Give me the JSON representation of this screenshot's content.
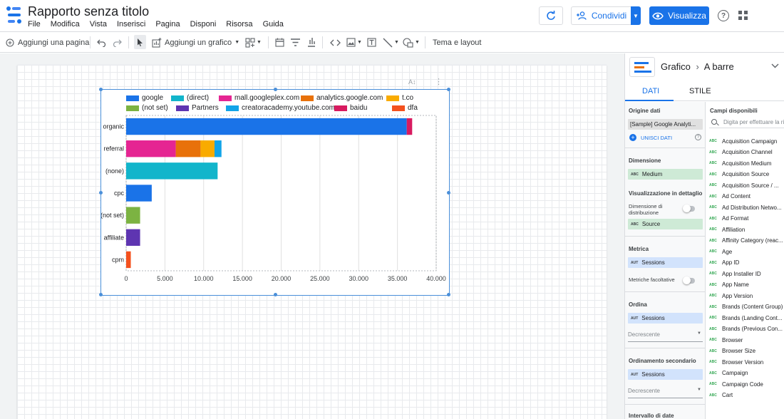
{
  "header": {
    "title": "Rapporto senza titolo",
    "menu": [
      "File",
      "Modifica",
      "Vista",
      "Inserisci",
      "Pagina",
      "Disponi",
      "Risorsa",
      "Guida"
    ],
    "share_label": "Condividi",
    "view_label": "Visualizza",
    "help_glyph": "?"
  },
  "toolbar": {
    "add_page": "Aggiungi una pagina",
    "add_chart": "Aggiungi un grafico",
    "theme_layout": "Tema e layout"
  },
  "chart_data": {
    "type": "bar",
    "orientation": "horizontal",
    "stacked": true,
    "categories": [
      "organic",
      "referral",
      "(none)",
      "cpc",
      "(not set)",
      "affiliate",
      "cpm"
    ],
    "series": [
      {
        "name": "google",
        "color": "#1a73e8",
        "values": [
          36200,
          0,
          0,
          3300,
          0,
          0,
          0
        ]
      },
      {
        "name": "(direct)",
        "color": "#12b5cb",
        "values": [
          0,
          0,
          11800,
          0,
          0,
          0,
          0
        ]
      },
      {
        "name": "mall.googleplex.com",
        "color": "#e52592",
        "values": [
          0,
          6400,
          0,
          0,
          0,
          0,
          0
        ]
      },
      {
        "name": "analytics.google.com",
        "color": "#e8710a",
        "values": [
          0,
          3200,
          0,
          0,
          0,
          0,
          0
        ]
      },
      {
        "name": "t.co",
        "color": "#f9ab00",
        "values": [
          0,
          1800,
          0,
          0,
          0,
          0,
          0
        ]
      },
      {
        "name": "(not set)",
        "color": "#7cb342",
        "values": [
          0,
          0,
          0,
          0,
          1800,
          0,
          0
        ]
      },
      {
        "name": "Partners",
        "color": "#5e35b1",
        "values": [
          0,
          0,
          0,
          0,
          0,
          1800,
          0
        ]
      },
      {
        "name": "creatoracademy.youtube.com",
        "color": "#12a4e8",
        "values": [
          0,
          900,
          0,
          0,
          0,
          0,
          0
        ]
      },
      {
        "name": "baidu",
        "color": "#d81b60",
        "values": [
          700,
          0,
          0,
          0,
          0,
          0,
          0
        ]
      },
      {
        "name": "dfa",
        "color": "#f4511e",
        "values": [
          0,
          0,
          0,
          0,
          0,
          0,
          600
        ]
      }
    ],
    "xlim": [
      0,
      40000
    ],
    "xticks": [
      "0",
      "5.000",
      "10.000",
      "15.000",
      "20.000",
      "25.000",
      "30.000",
      "35.000",
      "40.000"
    ],
    "grid": true,
    "legend_position": "top"
  },
  "panel": {
    "title": "Grafico",
    "subtitle": "A barre",
    "tab_data": "DATI",
    "tab_style": "STILE",
    "data_source_label": "Origine dati",
    "data_source_value": "[Sample] Google Analyti...",
    "blend_label": "UNISCI DATI",
    "dimension_label": "Dimensione",
    "dimension_value": "Medium",
    "drilldown_label": "Visualizzazione in dettaglio",
    "breakdown_label": "Dimensione di distribuzione",
    "breakdown_value": "Source",
    "metric_label": "Metrica",
    "metric_value": "Sessions",
    "optional_metrics_label": "Metriche facoltative",
    "sort_label": "Ordina",
    "sort_value": "Sessions",
    "sort_order": "Decrescente",
    "secondary_sort_label": "Ordinamento secondario",
    "secondary_sort_value": "Sessions",
    "secondary_sort_order": "Decrescente",
    "date_range_label": "Intervallo di date predefinito",
    "dim_tag": "ABC",
    "metric_tag": "AUT",
    "fields_title": "Campi disponibili",
    "search_placeholder": "Digita per effettuare la ricerca",
    "fields": [
      "Acquisition Campaign",
      "Acquisition Channel",
      "Acquisition Medium",
      "Acquisition Source",
      "Acquisition Source / ...",
      "Ad Content",
      "Ad Distribution Netwo...",
      "Ad Format",
      "Affiliation",
      "Affinity Category (reac...",
      "Age",
      "App ID",
      "App Installer ID",
      "App Name",
      "App Version",
      "Brands (Content Group)",
      "Brands (Landing Cont...",
      "Brands (Previous Con...",
      "Browser",
      "Browser Size",
      "Browser Version",
      "Campaign",
      "Campaign Code",
      "Cart"
    ]
  }
}
